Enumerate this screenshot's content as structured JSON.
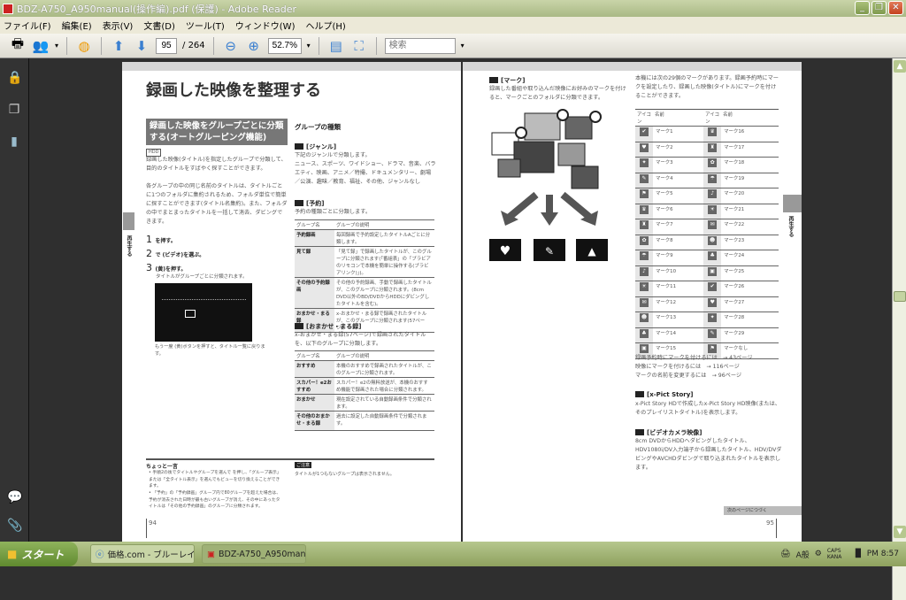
{
  "window": {
    "title": "BDZ-A750_A950manual(操作編).pdf (保護) - Adobe Reader"
  },
  "menu": [
    "ファイル(F)",
    "編集(E)",
    "表示(V)",
    "文書(D)",
    "ツール(T)",
    "ウィンドウ(W)",
    "ヘルプ(H)"
  ],
  "toolbar": {
    "page_current": "95",
    "page_total": "/ 264",
    "zoom": "52.7%",
    "search_placeholder": "検索"
  },
  "left_page": {
    "title": "録画した映像を整理する",
    "box_heading": "録画した映像をグループごとに分類する(オートグルーピング機能)",
    "hdd_badge": "HDD",
    "intro": "録画した映像(タイトル)を指定したグループで分類して、目的のタイトルをすばやく探すことができます。",
    "intro2": "各グループの中の同じ名前のタイトルは、タイトルごとに1つのフォルダに集約されるため、フォルダ単位で簡単に探すことができます(タイトル名集約)。また、フォルダの中でまとまったタイトルを一括して消去、ダビングできます。",
    "steps": [
      {
        "n": "1",
        "text": "を押す。"
      },
      {
        "n": "2",
        "text": "で (ビデオ)を選ぶ。"
      },
      {
        "n": "3",
        "text": "(黄)を押す。",
        "sub": "タイトルがグループごとに分類されます。"
      }
    ],
    "image_caption": "もう一度 (黄)ボタンを押すと、タイトル一覧に戻ります。",
    "side_tab": "再生する",
    "group_types_title": "グループの種類",
    "genre": {
      "label": "[ジャンル]",
      "desc": "下記のジャンルで分類します。",
      "list": "ニュース、スポーツ、ワイドショー、ドラマ、音楽、バラエティ、映画、アニメ／特撮、ドキュメンタリー、劇場／公演、趣味／教育、福祉、その他、ジャンルなし"
    },
    "reserve": {
      "label": "[予約]",
      "desc": "予約の種類ごとに分類します。",
      "headers": [
        "グループ名",
        "グループの説明"
      ],
      "rows": [
        [
          "予約録画",
          "毎回録画で予約設定したタイトルAごとに分類します。"
        ],
        [
          "見て録",
          "「見て録」で録画したタイトルが、このグループに分類されます(「番組表」の「ブラビアのリモコンで本機を簡単に操作する(ブラビアリンク)」)。"
        ],
        [
          "その他の予約録画",
          "その他の予約録画、手動で録画したタイトルが、このグループに分類されます。(8cm DVD以外のBD/DVDからHDDにダビングしたタイトルを含む)。"
        ],
        [
          "おまかせ・まる録",
          "x-おまかせ・まる録で録画されたタイトルが、このグループに分類されます(57ページ)。"
        ]
      ]
    },
    "omakase": {
      "label": "[おまかせ・まる録]",
      "desc": "x-おまかせ・まる録(57ページ)で録画されたタイトルを、以下のグループに分類します。",
      "headers": [
        "グループ名",
        "グループの説明"
      ],
      "rows": [
        [
          "おすすめ",
          "本機のおすすめで録画されたタイトルが、このグループに分類されます。"
        ],
        [
          "スカパー！e2おすすめ",
          "スカパー！e2の無料放送が、本機のおすすめ機能で録画された場合に分類されます。"
        ],
        [
          "おまかせ",
          "現在設定されている自動録画条件で分類されます。"
        ],
        [
          "その他のおまかせ・まる録",
          "過去に設定した自動録画条件で分類されます。"
        ]
      ]
    },
    "tip_title": "ちょっと一言",
    "tips": [
      "手順2の後でタイトルやグループを選んで を押し、「グループ表示」または「全タイトル表示」を選んでもビューを切り換えることができます。",
      "「予約」の「予約録画」グループ内で80グループを超えた場合は、予約が消去された日時が最も古いグループが消え、その中にあったタイトルは「その他の予約録画」のグループに分類されます。"
    ],
    "note_badge": "ご注意",
    "note": "タイトルが1つもないグループは表示されません。",
    "page_number": "94"
  },
  "right_page": {
    "mark": {
      "label": "[マーク]",
      "desc": "録画した番組や取り込んだ映像にお好みのマークを付けると、マークごとのフォルダに分類できます。"
    },
    "intro": "本機には次の29個のマークがあります。録画予約時にマークを設定したり、録画した映像(タイトル)にマークを付けることができます。",
    "table_headers": [
      "アイコン",
      "名前",
      "アイコン",
      "名前"
    ],
    "marks_left": [
      "マーク1",
      "マーク2",
      "マーク3",
      "マーク4",
      "マーク5",
      "マーク6",
      "マーク7",
      "マーク8",
      "マーク9",
      "マーク10",
      "マーク11",
      "マーク12",
      "マーク13",
      "マーク14",
      "マーク15"
    ],
    "marks_right": [
      "マーク16",
      "マーク17",
      "マーク18",
      "マーク19",
      "マーク20",
      "マーク21",
      "マーク22",
      "マーク23",
      "マーク24",
      "マーク25",
      "マーク26",
      "マーク27",
      "マーク28",
      "マーク29",
      "マークなし"
    ],
    "refs": [
      "録画予約時にマークを付けるには　→ 43ページ",
      "映像にマークを付けるには　→ 116ページ",
      "マークの名前を変更するには　→ 96ページ"
    ],
    "xpict": {
      "label": "[x-Pict Story]",
      "desc": "x-Pict Story HDで作成したx-Pict Story HD映像(または、そのプレイリストタイトル)を表示します。"
    },
    "camera": {
      "label": "[ビデオカメラ映像]",
      "desc": "8cm DVDからHDDへダビングしたタイトル、HDV1080i/DV入力端子から録画したタイトル、HDV/DVダビングやAVCHDダビングで取り込まれたタイトルを表示します。"
    },
    "continue": "次のページにつづく",
    "side_tab": "再生する",
    "page_number": "95"
  },
  "taskbar": {
    "start": "スタート",
    "tasks": [
      "価格.com - ブルーレイ...",
      "BDZ-A750_A950man..."
    ],
    "ime": "A般",
    "caps": "CAPS KANA",
    "clock": "PM 8:57"
  }
}
